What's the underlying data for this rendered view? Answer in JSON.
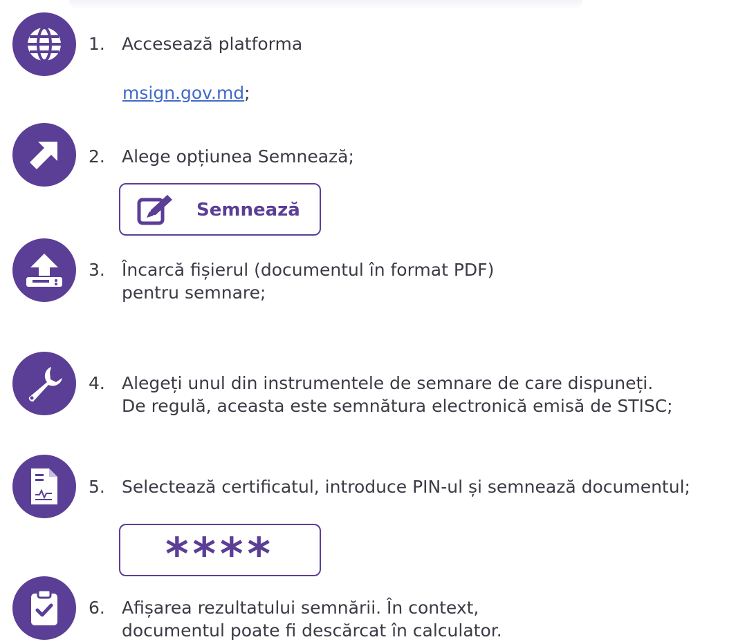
{
  "steps": [
    {
      "number": "1.",
      "lines": [
        "Accesează platforma"
      ],
      "icon": "globe-icon"
    },
    {
      "number": "2.",
      "lines": [
        "Alege opțiunea Semnează;"
      ],
      "icon": "arrow-up-right-icon"
    },
    {
      "number": "3.",
      "lines": [
        "Încarcă fișierul (documentul în format PDF)",
        "pentru semnare;"
      ],
      "icon": "upload-icon"
    },
    {
      "number": "4.",
      "lines": [
        "Alegeți unul din instrumentele de semnare de care dispuneți.",
        "De regulă, aceasta este semnătura electronică emisă de STISC;"
      ],
      "icon": "wrench-icon"
    },
    {
      "number": "5.",
      "lines": [
        "Selectează certificatul, introduce PIN-ul și semnează documentul;"
      ],
      "icon": "document-signature-icon"
    },
    {
      "number": "6.",
      "lines": [
        "Afișarea rezultatului semnării. În context,",
        "documentul poate fi descărcat în calculator."
      ],
      "icon": "clipboard-check-icon"
    }
  ],
  "link": {
    "text": "msign.gov.md",
    "suffix": ";"
  },
  "sign_button": {
    "label": "Semnează",
    "icon": "edit-icon"
  },
  "pin_box": {
    "text": "****"
  },
  "colors": {
    "accent": "#5b3e96",
    "text": "#3d3a45",
    "link": "#4169c9"
  }
}
